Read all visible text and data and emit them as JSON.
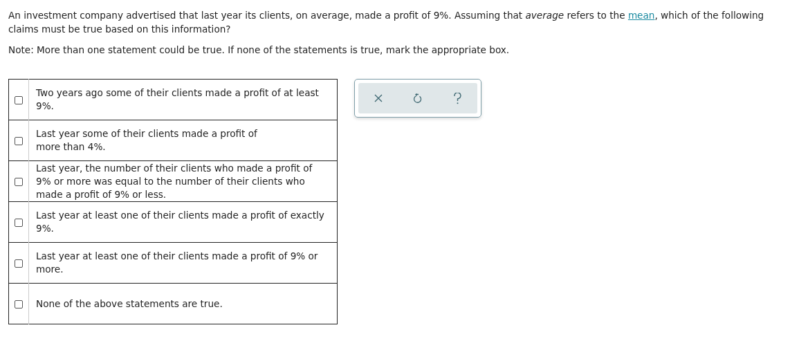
{
  "question": {
    "before": "An investment company advertised that last year its clients, on average, made a profit of 9%. Assuming that *average* refers to the ",
    "link": "mean",
    "after": ", which of the following claims must be true based on this information?"
  },
  "note": "Note: More than one statement could be true. If none of the statements is true, mark the appropriate box.",
  "options": [
    {
      "text": "Two years ago some of their clients made a profit of at least 9%.",
      "checked": false
    },
    {
      "text": "Last year some of their clients made a profit of\nmore than 4%.",
      "checked": false
    },
    {
      "text": "Last year, the number of their clients who made a profit of 9% or more was equal to the number of their clients who made a profit of 9% or less.",
      "checked": false
    },
    {
      "text": "Last year at least one of their clients made a profit of exactly 9%.",
      "checked": false
    },
    {
      "text": "Last year at least one of their clients made a profit of 9% or more.",
      "checked": false
    },
    {
      "text": "None of the above statements are true.",
      "checked": false
    }
  ]
}
